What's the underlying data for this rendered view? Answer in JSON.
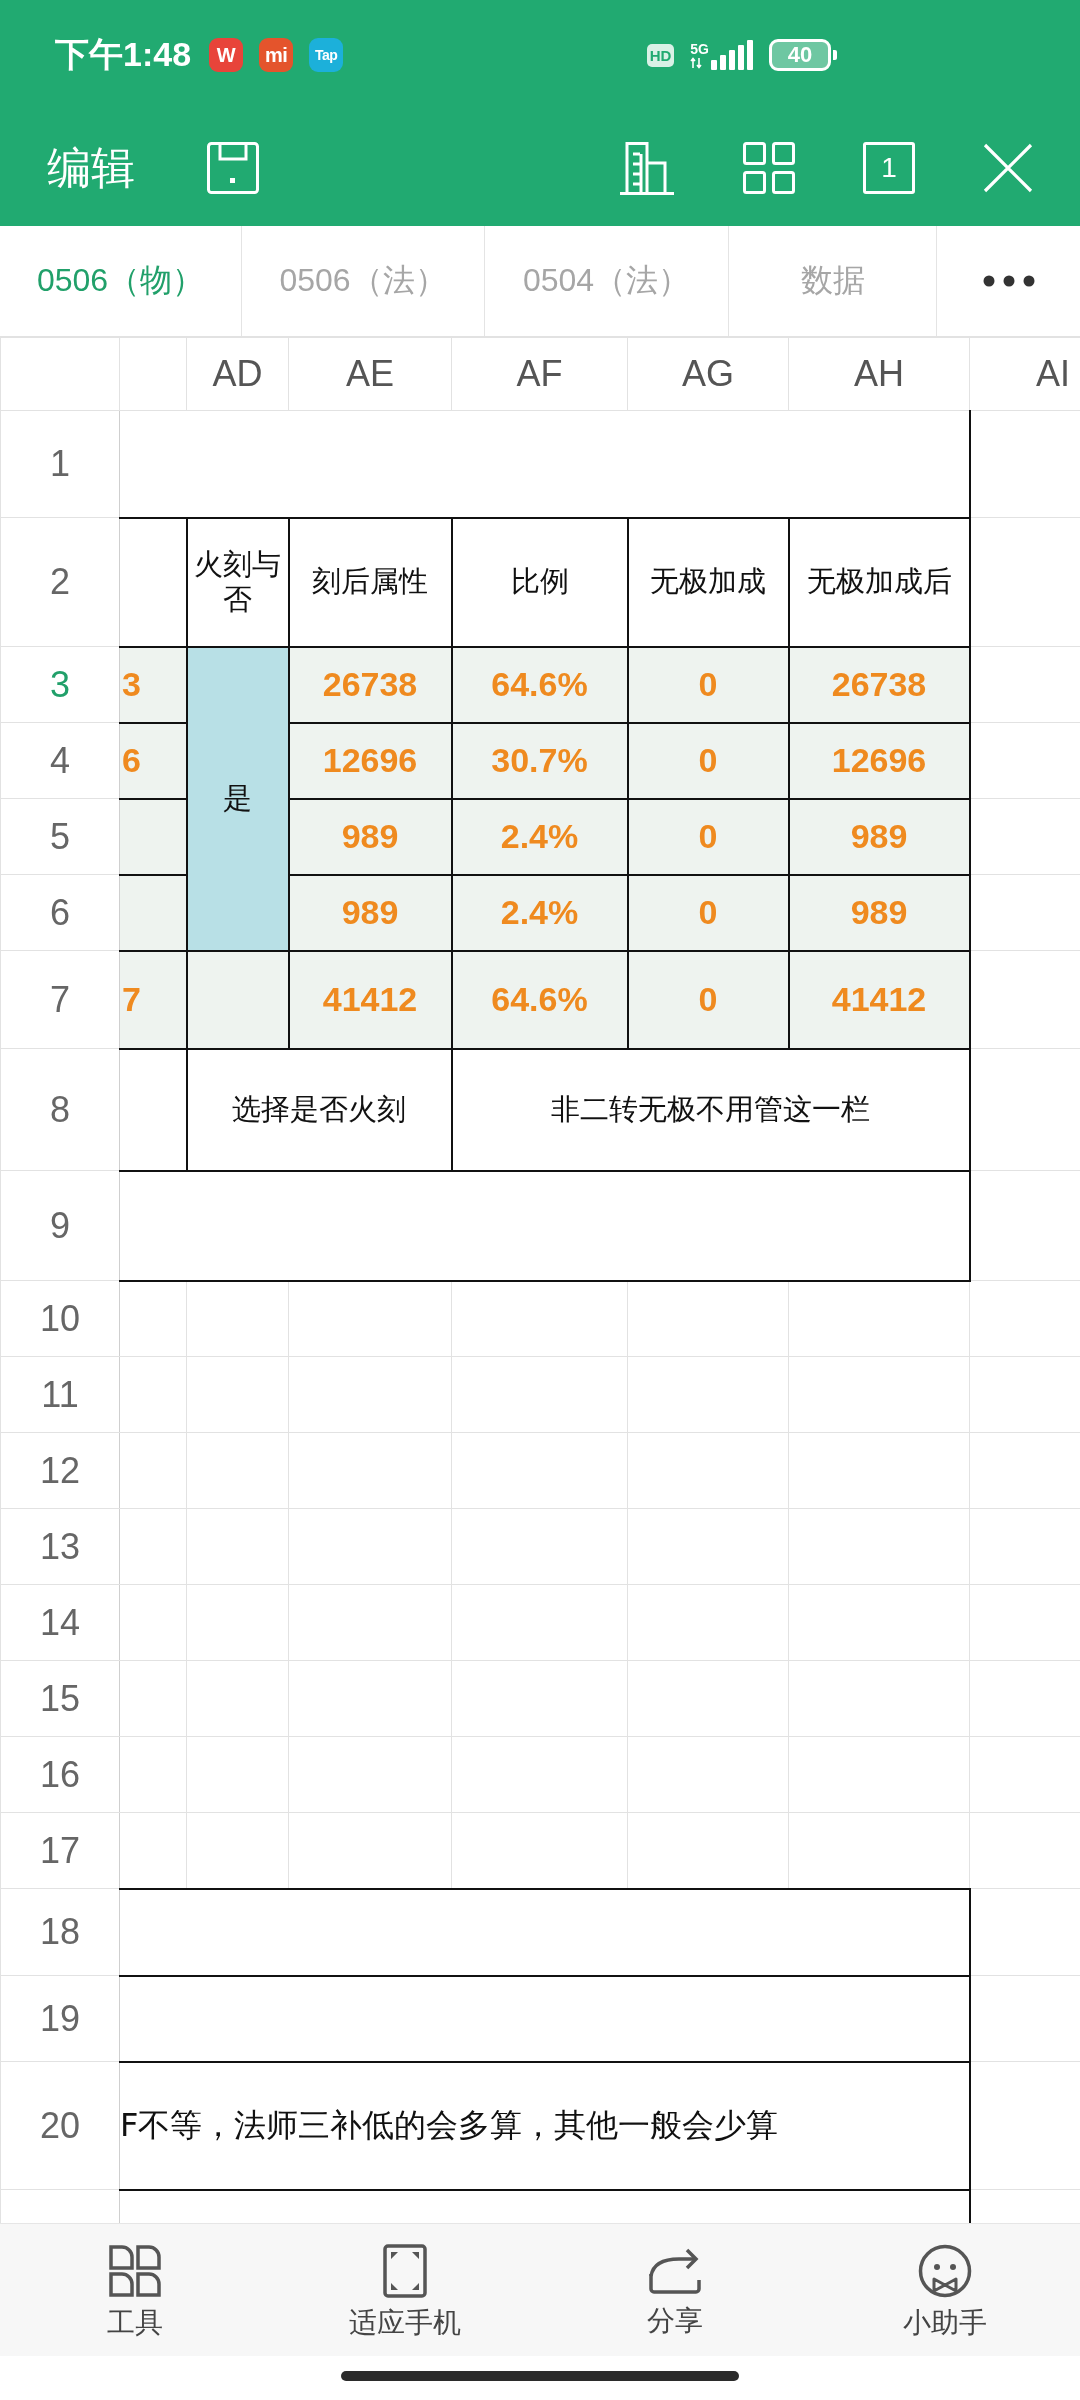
{
  "status_bar": {
    "time": "下午1:48",
    "notifications": [
      {
        "label": "W",
        "color": "#e8443a"
      },
      {
        "label": "mi",
        "color": "#e4542c"
      },
      {
        "label": "Tap",
        "color": "#1cb0da"
      }
    ],
    "hd": "HD",
    "network": "5G",
    "battery": "40"
  },
  "toolbar": {
    "title": "编辑",
    "left_actions": [
      {
        "kind": "save"
      }
    ],
    "right_actions": [
      {
        "kind": "building"
      },
      {
        "kind": "grid"
      },
      {
        "kind": "page-count",
        "label": "1"
      },
      {
        "kind": "close"
      }
    ]
  },
  "sheet_tabs": [
    {
      "label": "0506（物）",
      "selected": true
    },
    {
      "label": "0506（法）",
      "selected": false
    },
    {
      "label": "0504（法）",
      "selected": false
    },
    {
      "label": "数据",
      "selected": false
    }
  ],
  "sheet": {
    "columns": [
      "AD",
      "AE",
      "AF",
      "AG",
      "AH",
      "AI"
    ],
    "rows": [
      {
        "number": "1",
        "selected": false,
        "kind": "merged"
      },
      {
        "number": "2",
        "selected": false,
        "kind": "header",
        "cells": [
          "火刻与否",
          "刻后属性",
          "比例",
          "无极加成",
          "无极加成后"
        ]
      },
      {
        "number": "3",
        "selected": true,
        "kind": "data",
        "lead": "3",
        "flag": "是",
        "cells": [
          "26738",
          "64.6%",
          "0",
          "26738"
        ]
      },
      {
        "number": "4",
        "selected": false,
        "kind": "data",
        "lead": "6",
        "cells": [
          "12696",
          "30.7%",
          "0",
          "12696"
        ]
      },
      {
        "number": "5",
        "selected": false,
        "kind": "data",
        "cells": [
          "989",
          "2.4%",
          "0",
          "989"
        ]
      },
      {
        "number": "6",
        "selected": false,
        "kind": "data",
        "cells": [
          "989",
          "2.4%",
          "0",
          "989"
        ]
      },
      {
        "number": "7",
        "selected": false,
        "kind": "total",
        "lead": "7",
        "cells": [
          "41412",
          "64.6%",
          "0",
          "41412"
        ]
      },
      {
        "number": "8",
        "selected": false,
        "kind": "note",
        "cells": [
          "选择是否火刻",
          "非二转无极不用管这一栏"
        ]
      },
      {
        "number": "9",
        "selected": false,
        "kind": "merged"
      },
      {
        "number": "10",
        "selected": false,
        "kind": "empty"
      },
      {
        "number": "11",
        "selected": false,
        "kind": "empty"
      },
      {
        "number": "12",
        "selected": false,
        "kind": "empty"
      },
      {
        "number": "13",
        "selected": false,
        "kind": "empty"
      },
      {
        "number": "14",
        "selected": false,
        "kind": "empty"
      },
      {
        "number": "15",
        "selected": false,
        "kind": "empty"
      },
      {
        "number": "16",
        "selected": false,
        "kind": "empty"
      },
      {
        "number": "17",
        "selected": false,
        "kind": "empty"
      },
      {
        "number": "18",
        "selected": false,
        "kind": "merged"
      },
      {
        "number": "19",
        "selected": false,
        "kind": "merged"
      },
      {
        "number": "20",
        "selected": false,
        "kind": "merged",
        "text": "F不等，法师三补低的会多算，其他一般会少算"
      },
      {
        "kind": "merged"
      }
    ]
  },
  "bottom_bar": [
    {
      "kind": "tools",
      "label": "工具"
    },
    {
      "kind": "fit",
      "label": "适应手机"
    },
    {
      "kind": "share",
      "label": "分享"
    },
    {
      "kind": "assistant",
      "label": "小助手"
    }
  ]
}
